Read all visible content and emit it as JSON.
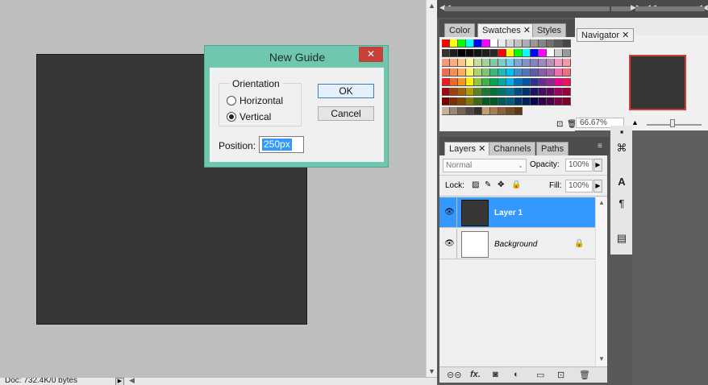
{
  "status": {
    "doc_info": "Doc: 732.4K/0 bytes"
  },
  "dialog": {
    "title": "New Guide",
    "close_glyph": "✕",
    "orientation_label": "Orientation",
    "horizontal_label": "Horizontal",
    "vertical_label": "Vertical",
    "selected": "vertical",
    "ok_label": "OK",
    "cancel_label": "Cancel",
    "position_label": "Position:",
    "position_value": "250px"
  },
  "swatch_tabs": {
    "color": "Color",
    "swatches": "Swatches",
    "styles": "Styles",
    "close_glyph": "✕"
  },
  "navigator": {
    "tab": "Navigator",
    "close_glyph": "✕",
    "zoom": "66.67%"
  },
  "layers": {
    "tabs": {
      "layers": "Layers",
      "channels": "Channels",
      "paths": "Paths",
      "close_glyph": "✕"
    },
    "blend_mode": "Normal",
    "opacity_label": "Opacity:",
    "opacity_value": "100%",
    "lock_label": "Lock:",
    "fill_label": "Fill:",
    "fill_value": "100%",
    "items": [
      {
        "name": "Layer 1",
        "selected": true
      },
      {
        "name": "Background",
        "selected": false
      }
    ],
    "footer_fx": "fx."
  },
  "colors": {
    "dialog_frame": "#6fc7b0",
    "selection": "#3399ff",
    "close_red": "#c8403a",
    "canvas": "#363636",
    "nav_frame": "#d33a3a"
  },
  "icons": [
    "eye-icon",
    "lock-icon",
    "link-icon",
    "fx-icon",
    "mask-icon",
    "adjustment-icon",
    "folder-icon",
    "new-layer-icon",
    "trash-icon",
    "type-icon",
    "paragraph-icon",
    "notes-icon"
  ],
  "swatch_colors": [
    [
      "#ff0000",
      "#ffff00",
      "#00ff00",
      "#00ffff",
      "#0000ff",
      "#ff00ff",
      "#ffffff",
      "#ebebeb",
      "#d6d6d6",
      "#c2c2c2",
      "#adadad",
      "#999999",
      "#858585",
      "#707070",
      "#5c5c5c",
      "#474747"
    ],
    [
      "#333333",
      "#1f1f1f",
      "#000000",
      "#0a0a0a",
      "#141414",
      "#1e1e1e",
      "#282828",
      "#ff0000",
      "#ffff00",
      "#00ff00",
      "#00ffff",
      "#0000ff",
      "#ff00ff",
      "#ffffff",
      "#cccccc",
      "#999999"
    ],
    [
      "#f7977a",
      "#f9ad81",
      "#fdc68a",
      "#fff79a",
      "#c4df9b",
      "#a2d39c",
      "#82ca9d",
      "#7bcdc8",
      "#6ecff6",
      "#7ea7d8",
      "#8493ca",
      "#8882be",
      "#a187be",
      "#bc8dbf",
      "#f49ac2",
      "#f6989d"
    ],
    [
      "#f26c4f",
      "#f68e55",
      "#fbaf5c",
      "#fff467",
      "#acd372",
      "#7cc576",
      "#3bb878",
      "#1abbb4",
      "#00bff3",
      "#438cca",
      "#5574b9",
      "#605ca8",
      "#855fa8",
      "#a763a8",
      "#f06ea9",
      "#f26d7d"
    ],
    [
      "#ed1c24",
      "#f26522",
      "#f7941d",
      "#fff200",
      "#8dc73f",
      "#39b54a",
      "#00a651",
      "#00a99d",
      "#00aeef",
      "#0072bc",
      "#0054a6",
      "#2e3192",
      "#662d91",
      "#92278f",
      "#ec008c",
      "#ed145b"
    ],
    [
      "#9e0b0f",
      "#a0410d",
      "#a36209",
      "#aba000",
      "#598527",
      "#1a7b30",
      "#007236",
      "#00746b",
      "#0076a3",
      "#004b80",
      "#003471",
      "#1b1464",
      "#440e62",
      "#630460",
      "#9e005d",
      "#9e0039"
    ],
    [
      "#790000",
      "#7b2e00",
      "#7d4900",
      "#827b00",
      "#406618",
      "#005e20",
      "#005826",
      "#005952",
      "#005b7f",
      "#003663",
      "#002157",
      "#0d004c",
      "#32004b",
      "#4b0049",
      "#7b0046",
      "#7a0026"
    ],
    [
      "#c7b299",
      "#998675",
      "#736357",
      "#534741",
      "#37302a",
      "#c69c6d",
      "#a67c52",
      "#8c6239",
      "#754c24",
      "#603913"
    ]
  ]
}
